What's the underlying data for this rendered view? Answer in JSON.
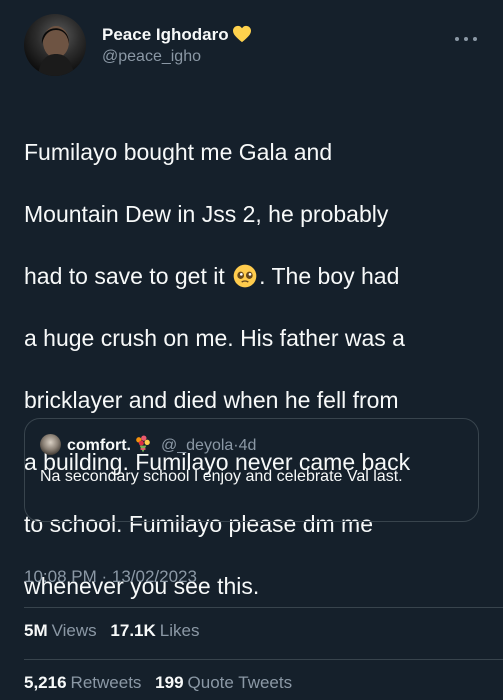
{
  "author": {
    "display_name": "Peace Ighodaro",
    "username": "@peace_igho",
    "name_emoji_icon": "yellow-heart-icon"
  },
  "tweet": {
    "lines": [
      "Fumilayo bought me Gala and",
      "Mountain Dew in Jss 2, he probably",
      "had to save to get it",
      ". The boy had",
      "a huge crush on me. His father was a",
      "bricklayer and died when he fell from",
      "a building. Fumilayo never came back",
      "to school. Fumilayo please dm me",
      "whenever you see this."
    ],
    "inline_emoji_icon": "pleading-face-icon"
  },
  "quote": {
    "display_name": "comfort.",
    "name_emoji_icon": "bouquet-icon",
    "handle": "@_deyola",
    "separator": "·",
    "time": "4d",
    "text": "Na secondary school I enjoy and celebrate Val last."
  },
  "meta": {
    "timestamp": "10:08 PM · 13/02/2023"
  },
  "stats": {
    "views_count": "5M",
    "views_label": "Views",
    "likes_count": "17.1K",
    "likes_label": "Likes",
    "retweets_count": "5,216",
    "retweets_label": "Retweets",
    "quote_count": "199",
    "quote_label": "Quote Tweets"
  },
  "colors": {
    "background": "#15202b",
    "primary_text": "#f7f9f9",
    "secondary_text": "#8b98a5",
    "border": "#38444d",
    "heart": "#ffd24d"
  }
}
